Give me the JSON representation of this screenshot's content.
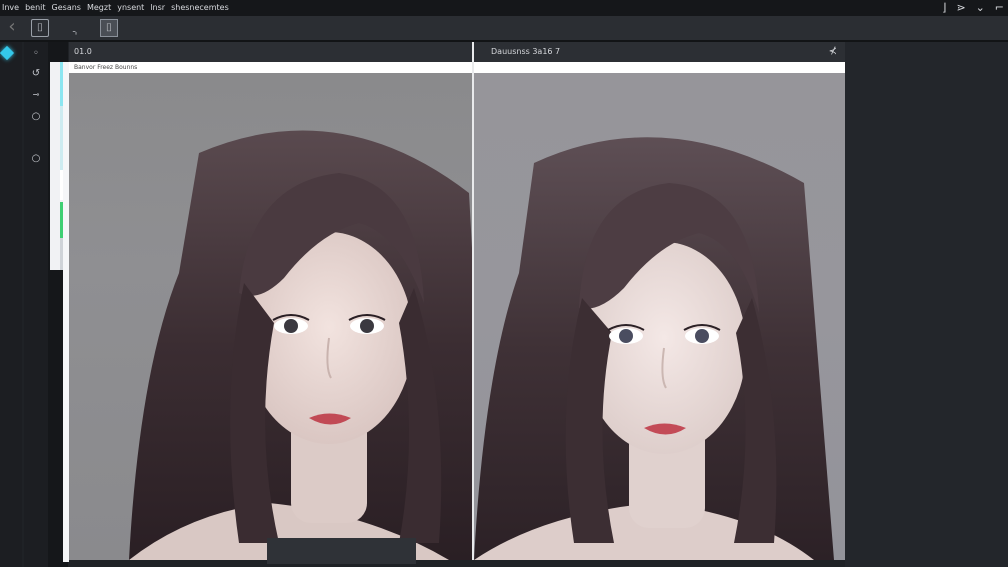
{
  "menubar": {
    "items": [
      "Inve",
      "benit",
      "Gesans",
      "Megzt",
      "ynsent",
      "lnsr",
      "shesnecemtes"
    ],
    "controls": [
      "⌋",
      "⋗",
      "⌄",
      "⌐"
    ]
  },
  "toolbar": {
    "tools": [
      "‹",
      "⌷",
      "⌍",
      "⌷"
    ]
  },
  "tools_column": [
    "◦",
    "↺",
    "⊸",
    "○",
    "○"
  ],
  "tabs": {
    "left_label": "01.0",
    "right_label": "Dauusnss 3a16 7",
    "close": "⊀"
  },
  "status": {
    "text": "Banvor Freez  Bounns"
  },
  "colors": {
    "accent": "#34c8ea",
    "swatch_cyan": "#8ce6f1",
    "swatch_green": "#3fcf73",
    "bg_dark": "#1f2226"
  }
}
